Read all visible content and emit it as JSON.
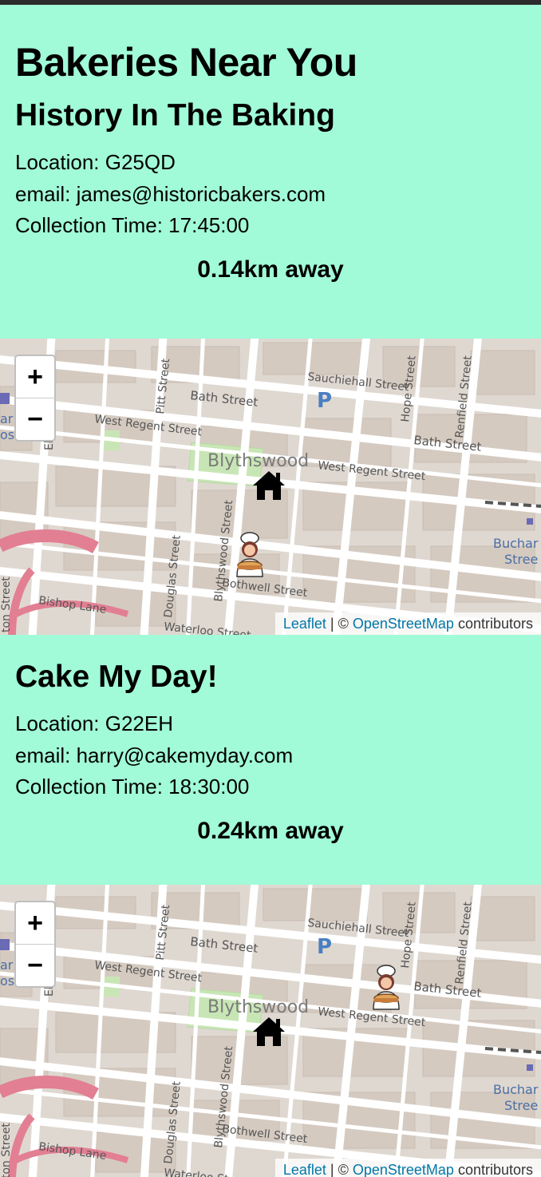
{
  "page": {
    "title": "Bakeries Near You"
  },
  "bakeries": [
    {
      "name": "History In The Baking",
      "location_label": "Location: G25QD",
      "email_label": "email: james@historicbakers.com",
      "collection_label": "Collection Time: 17:45:00",
      "distance_label": "0.14km away"
    },
    {
      "name": "Cake My Day!",
      "location_label": "Location: G22EH",
      "email_label": "email: harry@cakemyday.com",
      "collection_label": "Collection Time: 18:30:00",
      "distance_label": "0.24km away"
    }
  ],
  "map": {
    "zoom_in": "+",
    "zoom_out": "−",
    "attribution": {
      "leaflet": "Leaflet",
      "separator": " | © ",
      "osm": "OpenStreetMap",
      "suffix": " contributors"
    },
    "labels": {
      "sauchiehall": "Sauchiehall Street",
      "bath_top": "Bath Street",
      "bath_right": "Bath Street",
      "west_regent_left": "West Regent Street",
      "west_regent_right": "West Regent Street",
      "blythswood": "Blythswood",
      "pitt": "Pitt Street",
      "hope": "Hope Street",
      "renfield": "Renfield Street",
      "blythswood_st": "Blythswood Street",
      "douglas": "Douglas Street",
      "bothwell": "Bothwell Street",
      "waterloo": "Waterloo Street",
      "bishop": "Bishop Lane",
      "elmbank": "Elmba",
      "buchanan_1": "Buchar",
      "buchanan_2": "Stree",
      "parking": "P",
      "left_edge_1": "ar",
      "left_edge_2": "os",
      "left_edge_3": "ton Street"
    },
    "icons": {
      "home": "home-icon",
      "baker": "baker-icon"
    }
  },
  "colors": {
    "card_bg": "#a1fad8",
    "map_bg": "#dfd8d1",
    "road": "#ffffff",
    "motorway": "#e27f93",
    "link": "#0078a8",
    "park": "#c8e6b5",
    "parking": "#4a7fc1"
  }
}
